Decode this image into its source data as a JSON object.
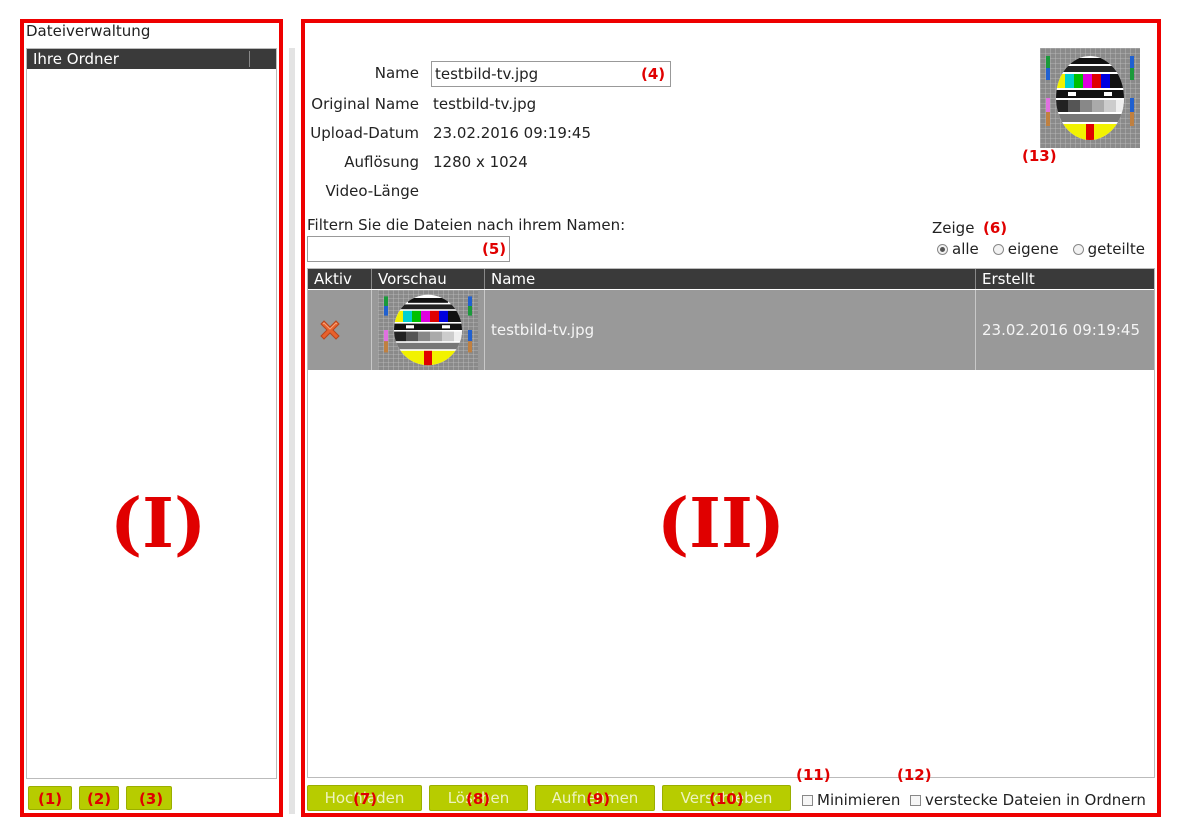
{
  "left_panel": {
    "title": "Dateiverwaltung",
    "folder_header": "Ihre Ordner",
    "region_label": "(I)",
    "buttons": [
      {
        "annotation": "(1)"
      },
      {
        "annotation": "(2)"
      },
      {
        "annotation": "(3)"
      }
    ]
  },
  "details": {
    "name_label": "Name",
    "name_value": "testbild-tv.jpg",
    "name_annotation": "(4)",
    "original_name_label": "Original Name",
    "original_name_value": "testbild-tv.jpg",
    "upload_label": "Upload-Datum",
    "upload_value": "23.02.2016 09:19:45",
    "resolution_label": "Auflösung",
    "resolution_value": "1280 x 1024",
    "video_length_label": "Video-Länge",
    "video_length_value": "",
    "thumbnail_annotation": "(13)"
  },
  "filter": {
    "label": "Filtern Sie die Dateien nach ihrem Namen:",
    "value": "",
    "annotation": "(5)"
  },
  "show": {
    "label": "Zeige",
    "annotation": "(6)",
    "options": [
      "alle",
      "eigene",
      "geteilte"
    ],
    "selected": "alle"
  },
  "table": {
    "columns": [
      "Aktiv",
      "Vorschau",
      "Name",
      "Erstellt"
    ],
    "rows": [
      {
        "name": "testbild-tv.jpg",
        "created": "23.02.2016 09:19:45"
      }
    ]
  },
  "main_region_label": "(II)",
  "actions": {
    "upload": {
      "label": "Hochladen",
      "annotation": "(7)"
    },
    "delete": {
      "label": "Löschen",
      "annotation": "(8)"
    },
    "record": {
      "label": "Aufnehmen",
      "annotation": "(9)"
    },
    "move": {
      "label": "Verschieben",
      "annotation": "(10)"
    }
  },
  "options": {
    "minimize": {
      "label": "Minimieren",
      "annotation": "(11)"
    },
    "hide_files": {
      "label": "verstecke Dateien in Ordnern",
      "annotation": "(12)"
    }
  },
  "colors": {
    "annotation_red": "#e00000",
    "button_green": "#b7cc00",
    "header_dark": "#3a3a3a",
    "selected_row": "#999999"
  }
}
